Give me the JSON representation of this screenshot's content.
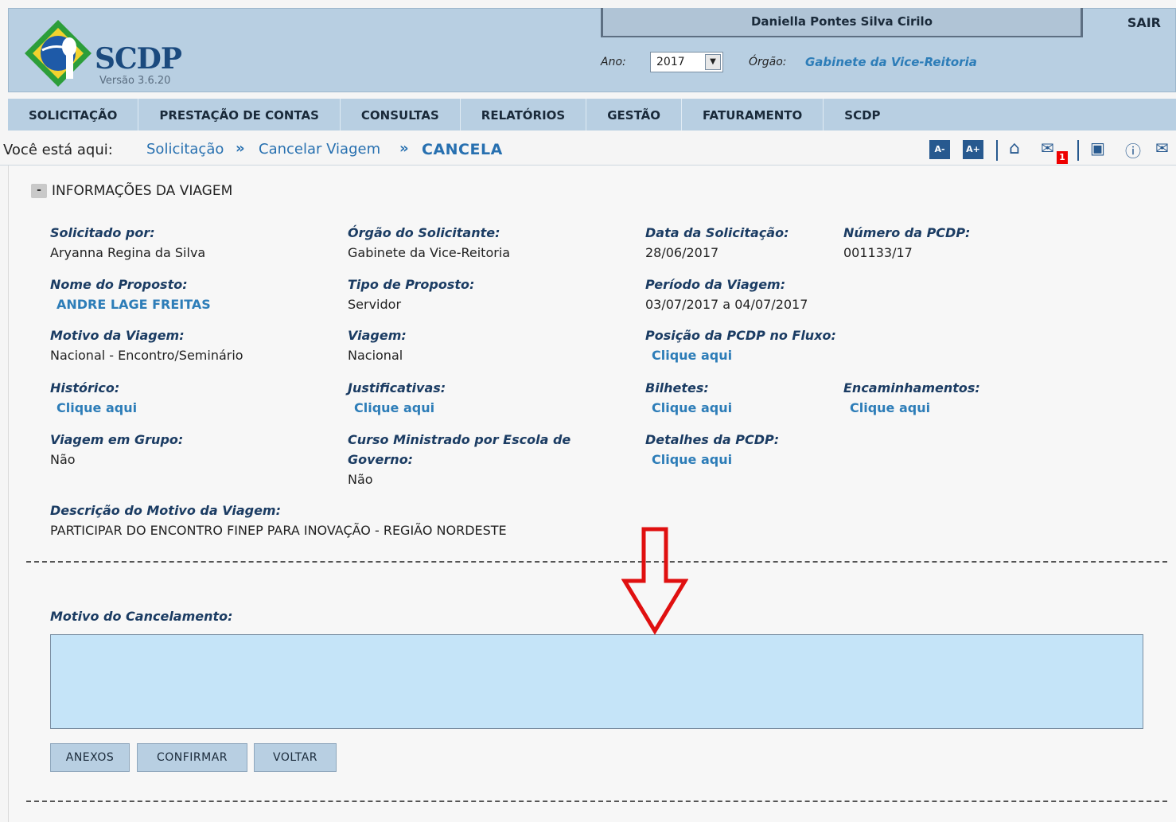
{
  "header": {
    "logo_title": "SCDP",
    "version": "Versão 3.6.20",
    "user_name": "Daniella Pontes Silva Cirilo",
    "sair": "SAIR",
    "ano_label": "Ano:",
    "ano_value": "2017",
    "orgao_label": "Órgão:",
    "orgao_value": "Gabinete da Vice-Reitoria"
  },
  "menu": [
    "SOLICITAÇÃO",
    "PRESTAÇÃO DE CONTAS",
    "CONSULTAS",
    "RELATÓRIOS",
    "GESTÃO",
    "FATURAMENTO",
    "SCDP"
  ],
  "breadcrumb": {
    "label": "Você está aqui:",
    "items": [
      "Solicitação",
      "Cancelar Viagem"
    ],
    "current": "CANCELA"
  },
  "tools": {
    "font_decrease": "A-",
    "font_increase": "A+",
    "message_count": "1"
  },
  "section": {
    "toggle": "-",
    "title": "INFORMAÇÕES DA VIAGEM"
  },
  "fields": {
    "solicitado_por": {
      "label": "Solicitado por:",
      "value": "Aryanna Regina da Silva"
    },
    "orgao_solicitante": {
      "label": "Órgão do Solicitante:",
      "value": "Gabinete da Vice-Reitoria"
    },
    "data_solicitacao": {
      "label": "Data da Solicitação:",
      "value": "28/06/2017"
    },
    "numero_pcdp": {
      "label": "Número da PCDP:",
      "value": "001133/17"
    },
    "nome_proposto": {
      "label": "Nome do Proposto:",
      "value": "ANDRE LAGE FREITAS"
    },
    "tipo_proposto": {
      "label": "Tipo de Proposto:",
      "value": "Servidor"
    },
    "periodo_viagem": {
      "label": "Período da Viagem:",
      "value": "03/07/2017 a 04/07/2017"
    },
    "motivo_viagem": {
      "label": "Motivo da Viagem:",
      "value": "Nacional - Encontro/Seminário"
    },
    "viagem": {
      "label": "Viagem:",
      "value": "Nacional"
    },
    "posicao_fluxo": {
      "label": "Posição da PCDP no Fluxo:",
      "value": "Clique aqui"
    },
    "historico": {
      "label": "Histórico:",
      "value": "Clique aqui"
    },
    "justificativas": {
      "label": "Justificativas:",
      "value": "Clique aqui"
    },
    "bilhetes": {
      "label": "Bilhetes:",
      "value": "Clique aqui"
    },
    "encaminhamentos": {
      "label": "Encaminhamentos:",
      "value": "Clique aqui"
    },
    "viagem_grupo": {
      "label": "Viagem em Grupo:",
      "value": "Não"
    },
    "curso_ministrado": {
      "label_line1": "Curso Ministrado por Escola de",
      "label_line2": "Governo:",
      "value": "Não"
    },
    "detalhes_pcdp": {
      "label": "Detalhes da PCDP:",
      "value": "Clique aqui"
    },
    "descricao_motivo": {
      "label": "Descrição do Motivo da Viagem:",
      "value": "PARTICIPAR DO ENCONTRO FINEP PARA INOVAÇÃO - REGIÃO NORDESTE"
    }
  },
  "cancel": {
    "label": "Motivo do Cancelamento:",
    "value": ""
  },
  "buttons": {
    "anexos": "ANEXOS",
    "confirmar": "CONFIRMAR",
    "voltar": "VOLTAR"
  },
  "colors": {
    "header_bg": "#b8cfe2",
    "link": "#2d7db8",
    "label": "#1b3c63",
    "textarea_bg": "#c5e4f8",
    "annotation_arrow": "#e01010"
  }
}
